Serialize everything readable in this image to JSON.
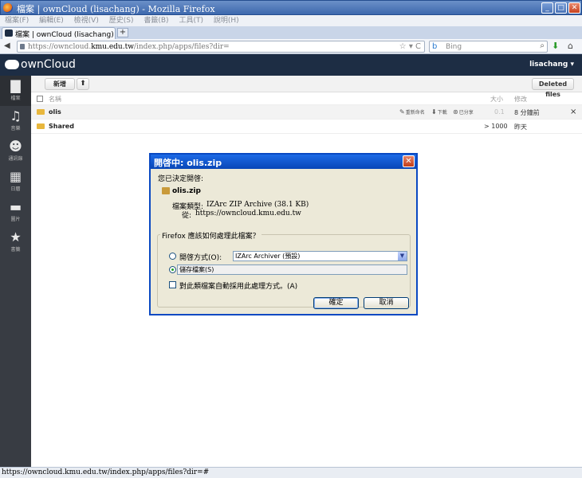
{
  "window": {
    "title": "檔案 | ownCloud (lisachang) - Mozilla Firefox",
    "min_glyph": "_",
    "max_glyph": "□",
    "close_glyph": "✕"
  },
  "menu": [
    "檔案(F)",
    "編輯(E)",
    "檢視(V)",
    "歷史(S)",
    "書籤(B)",
    "工具(T)",
    "說明(H)"
  ],
  "tab": {
    "label": "檔案 | ownCloud (lisachang)",
    "new_tab_glyph": "+"
  },
  "navbar": {
    "back_glyph": "◀",
    "url_prefix": "https://owncloud.",
    "url_domain": "kmu.edu.tw",
    "url_path": "/index.php/apps/files?dir=",
    "url_icons": "☆ ▾ C",
    "search_engine_glyph": "b",
    "search_placeholder": "Bing",
    "search_glyph": "⌕",
    "download_glyph": "⬇",
    "home_glyph": "⌂"
  },
  "owncloud": {
    "logo_text": "ownCloud",
    "user": "lisachang ▾",
    "nav": [
      {
        "label": "檔案",
        "icon": "files-icon",
        "glyph": "▇"
      },
      {
        "label": "音樂",
        "icon": "music-icon",
        "glyph": "♫"
      },
      {
        "label": "通訊錄",
        "icon": "contacts-icon",
        "glyph": "☻"
      },
      {
        "label": "日曆",
        "icon": "calendar-icon",
        "glyph": "▦"
      },
      {
        "label": "圖片",
        "icon": "pictures-icon",
        "glyph": "▬"
      },
      {
        "label": "書籤",
        "icon": "bookmarks-icon",
        "glyph": "★"
      }
    ],
    "new_button": "新增",
    "upload_glyph": "⬆",
    "deleted_files_button": "Deleted files",
    "table_headers": {
      "name": "名稱",
      "size": "大小",
      "modified": "修改"
    },
    "rows": [
      {
        "name": "olis",
        "size": "0.1",
        "modified": "8 分鐘前",
        "actions": {
          "rename": "重新命名",
          "download": "下載",
          "share": "已分享"
        }
      },
      {
        "name": "Shared",
        "size": "> 1000",
        "modified": "昨天"
      }
    ],
    "delete_glyph": "×"
  },
  "dialog": {
    "title": "開啓中: olis.zip",
    "close_glyph": "✕",
    "intro": "您已決定開啓:",
    "filename": "olis.zip",
    "type_label": "檔案類型:",
    "type_value": "IZArc ZIP Archive (38.1 KB)",
    "from_label": "從:",
    "from_value": "https://owncloud.kmu.edu.tw",
    "question": "Firefox 應該如何處理此檔案？",
    "open_with_label": "開啓方式(O):",
    "open_with_value": "IZArc Archiver (預設)",
    "select_arrow_glyph": "▼",
    "save_label": "儲存檔案(S)",
    "auto_label": "對此類檔案自動採用此處理方式。(A)",
    "ok_button": "確定",
    "cancel_button": "取消",
    "selected_option": "save"
  },
  "status": {
    "text": "https://owncloud.kmu.edu.tw/index.php/apps/files?dir=#"
  }
}
